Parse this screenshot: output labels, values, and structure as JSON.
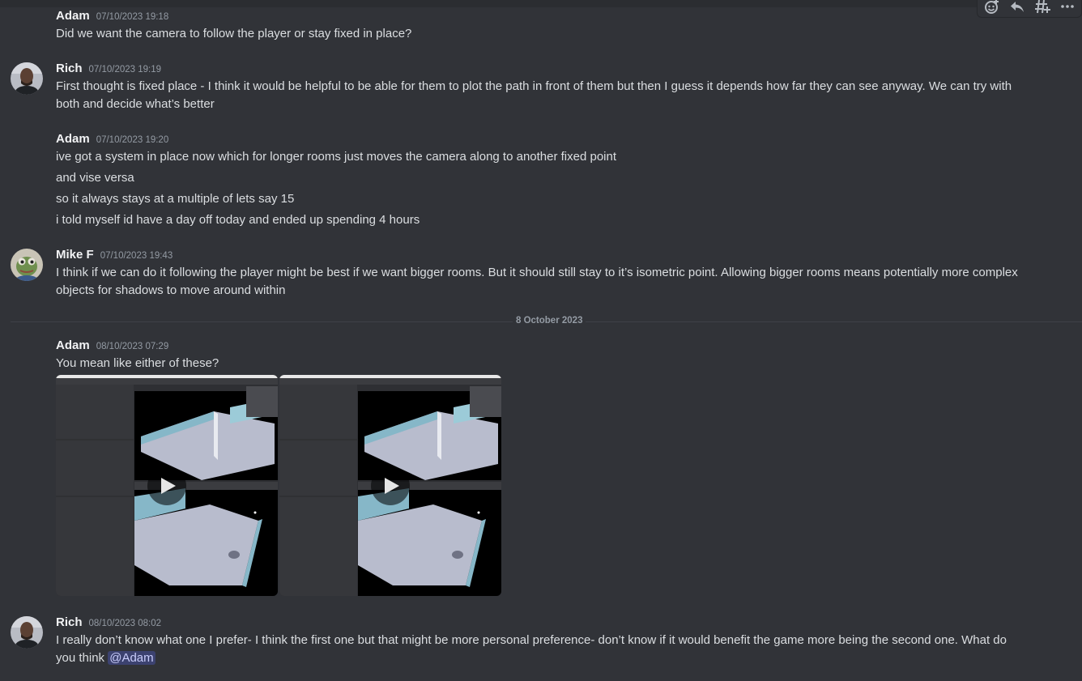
{
  "toolbar": {
    "icons": [
      "add-reaction-icon",
      "reply-icon",
      "create-thread-icon",
      "more-icon"
    ]
  },
  "messages": [
    {
      "user": "Adam",
      "time": "07/10/2023 19:18",
      "lines": [
        "Did we want the camera to follow the player or stay fixed in place?"
      ]
    },
    {
      "user": "Rich",
      "time": "07/10/2023 19:19",
      "lines": [
        "First thought is fixed place - I think it would be helpful to be able for them to plot the path in front of them but then I guess it depends how far they can see anyway. We can try with",
        "both and decide what’s better"
      ]
    },
    {
      "user": "Adam",
      "time": "07/10/2023 19:20",
      "lines": [
        "ive got a system in place now which for longer rooms just moves the camera along to another fixed point",
        "and vise versa",
        "so it always stays at a multiple of lets say 15",
        "i told myself id have a day off today and ended up spending 4 hours"
      ]
    },
    {
      "user": "Mike F",
      "time": "07/10/2023 19:43",
      "lines": [
        "I think if we can do it following the player might be best if we want bigger rooms. But it should still stay to it’s isometric point. Allowing bigger rooms means potentially more complex",
        "objects for shadows to move around within"
      ]
    },
    {
      "user": "Adam",
      "time": "08/10/2023 07:29",
      "lines": [
        "You mean like either of these?"
      ]
    },
    {
      "user": "Rich",
      "time": "08/10/2023 08:02",
      "lines": [
        "I really don’t know what one I prefer- I think the first one but that might be more personal preference- don’t know if it would benefit the game more being the second one. What do",
        "you think "
      ],
      "mention": "@Adam"
    }
  ],
  "date_divider": "8 October 2023",
  "colors": {
    "background": "#313338",
    "mention_bg": "#3c4270",
    "mention_text": "#c9cdfb",
    "timestamp": "#949ba4"
  }
}
